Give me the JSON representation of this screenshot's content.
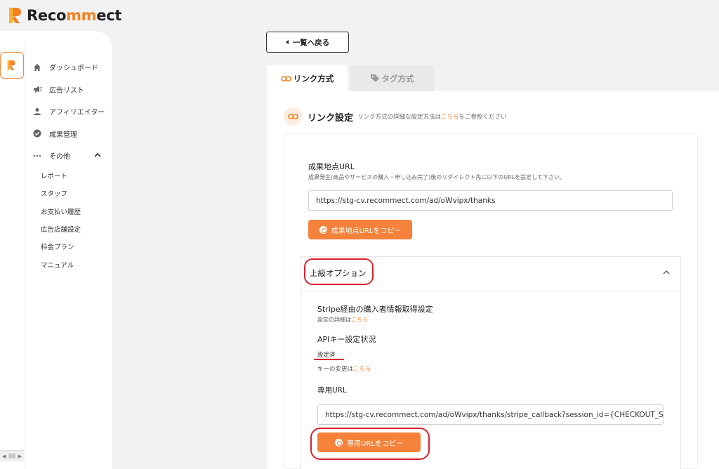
{
  "brand": {
    "name_part1": "Reco",
    "name_accent": "mm",
    "name_part2": "ect",
    "accent_color": "#f58220"
  },
  "sidebar": {
    "items": [
      {
        "label": "ダッシュボード",
        "icon": "home-icon"
      },
      {
        "label": "広告リスト",
        "icon": "megaphone-icon"
      },
      {
        "label": "アフィリエイター",
        "icon": "person-icon"
      },
      {
        "label": "成果管理",
        "icon": "check-circle-icon"
      },
      {
        "label": "その他",
        "icon": "more-dots-icon",
        "expanded": true
      }
    ],
    "sub_items": [
      "レポート",
      "スタッフ",
      "お支払い履歴",
      "広告店舗設定",
      "料金プラン",
      "マニュアル"
    ]
  },
  "back_button": {
    "label": "一覧へ戻る"
  },
  "tabs": [
    {
      "label": "リンク方式",
      "icon": "link-icon",
      "active": true
    },
    {
      "label": "タグ方式",
      "icon": "tag-icon",
      "active": false
    }
  ],
  "link_settings": {
    "title": "リンク設定",
    "desc_prefix": "リンク方式の詳細な設定方法は",
    "desc_link": "こちら",
    "desc_suffix": "をご参照ください"
  },
  "conversion": {
    "label": "成果地点URL",
    "help": "成果発生(商品やサービスの購入・申し込み完了)後のリダイレクト先に以下のURLを設定して下さい。",
    "url": "https://stg-cv.recommect.com/ad/oWvipx/thanks",
    "copy_label": "成果地点URLをコピー"
  },
  "advanced": {
    "title": "上級オプション",
    "stripe_title": "Stripe経由の購入者情報取得設定",
    "stripe_detail_prefix": "設定の詳細は",
    "stripe_detail_link": "こちら",
    "api_title": "APIキー設定状況",
    "api_status": "設定済",
    "key_change_prefix": "キーの変更は",
    "key_change_link": "こちら",
    "dedicated_label": "専用URL",
    "dedicated_url": "https://stg-cv.recommect.com/ad/oWvipx/thanks/stripe_callback?session_id={CHECKOUT_SESSION_ID}",
    "copy_label": "専用URLをコピー"
  }
}
